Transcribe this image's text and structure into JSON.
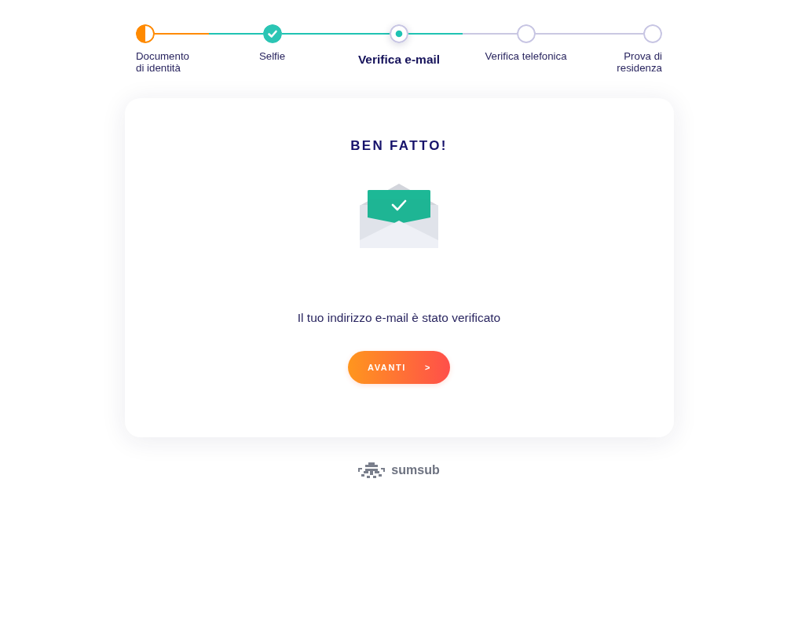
{
  "steps": [
    {
      "label": "Documento di identità",
      "kind": "partial"
    },
    {
      "label": "Selfie",
      "kind": "done"
    },
    {
      "label": "Verifica e-mail",
      "kind": "current"
    },
    {
      "label": "Verifica telefonica",
      "kind": "pending"
    },
    {
      "label": "Prova di residenza",
      "kind": "pending"
    }
  ],
  "card": {
    "title": "BEN FATTO!",
    "message": "Il tuo indirizzo e-mail è stato verificato",
    "button": {
      "label": "AVANTI",
      "arrow": ">"
    }
  },
  "footer": {
    "brand": "sumsub"
  }
}
